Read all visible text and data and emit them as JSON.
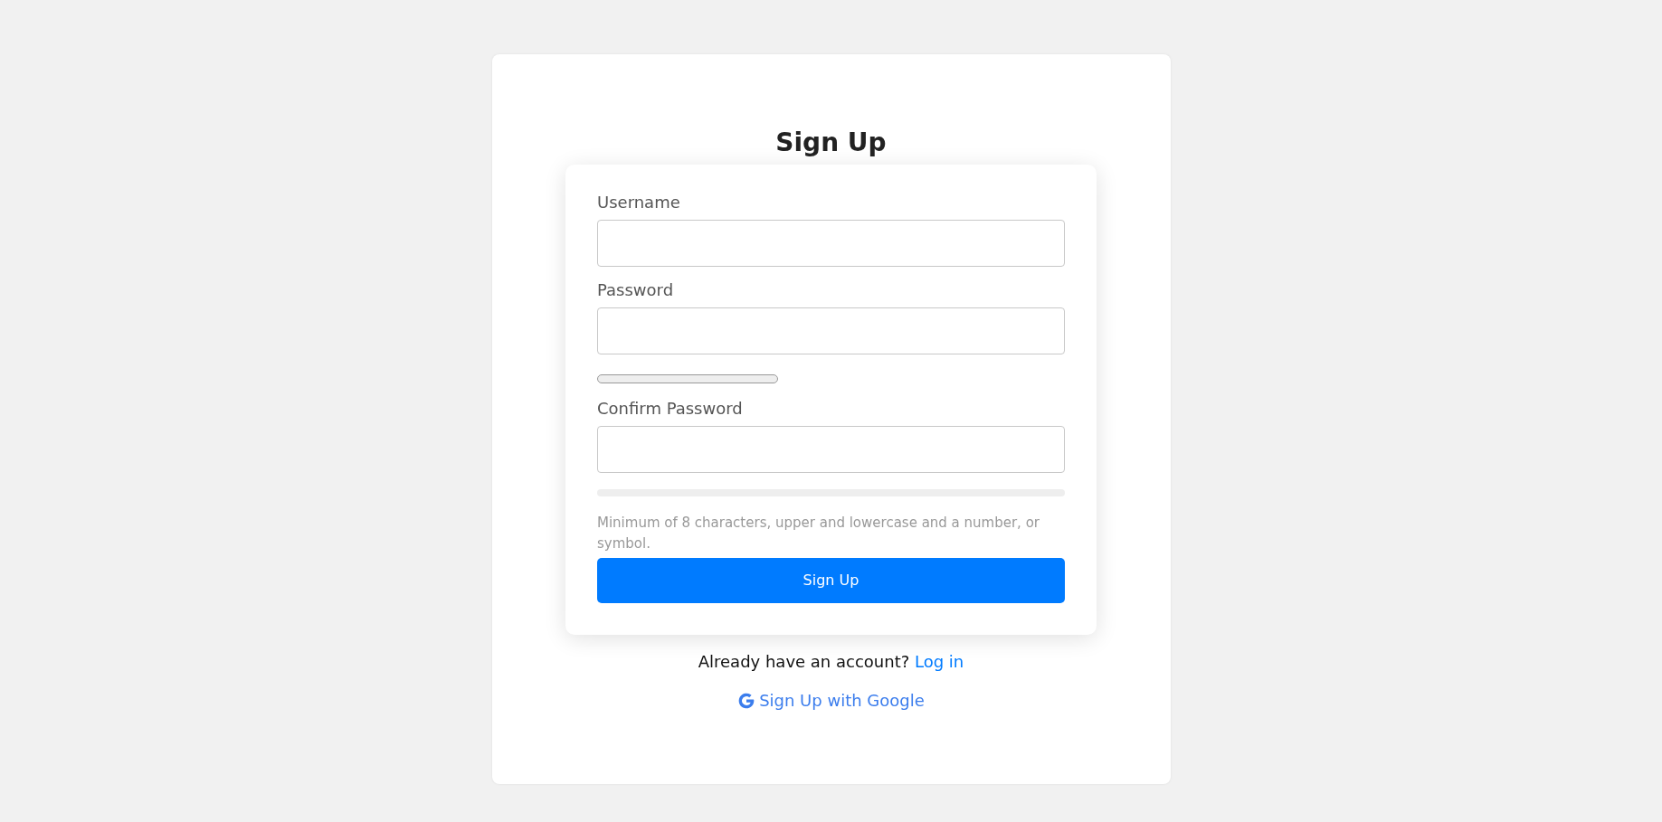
{
  "title": "Sign Up",
  "fields": [
    {
      "label": "Username"
    },
    {
      "label": "Password"
    }
  ],
  "strength_meter": {
    "kind": "meter",
    "level": 0
  },
  "confirm_field": {
    "label": "Confirm Password"
  },
  "match_bar": {
    "kind": "bar",
    "level": 0
  },
  "hint": "Minimum of 8 characters, upper and lowercase and a number, or symbol.",
  "submit_button": "Sign Up",
  "login_prompt": {
    "text": "Already have an account?",
    "link": "Log in"
  },
  "google_link": "Sign Up with Google"
}
